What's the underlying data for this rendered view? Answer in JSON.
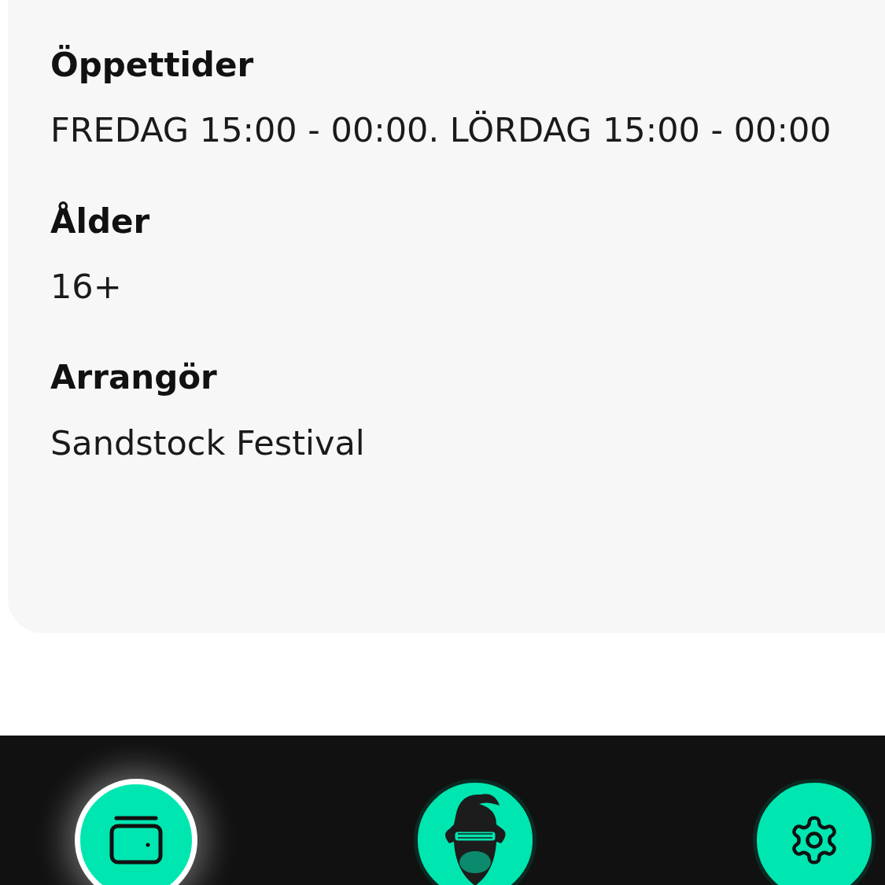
{
  "info_card": {
    "sections": [
      {
        "heading": "Öppettider",
        "value": "FREDAG 15:00 - 00:00. LÖRDAG 15:00 - 00:00"
      },
      {
        "heading": "Ålder",
        "value": "16+"
      },
      {
        "heading": "Arrangör",
        "value": "Sandstock Festival"
      }
    ]
  },
  "bottom_nav": {
    "items": [
      {
        "kind": "wallet",
        "selected": true
      },
      {
        "kind": "logo",
        "selected": false
      },
      {
        "kind": "settings",
        "selected": false
      }
    ]
  }
}
